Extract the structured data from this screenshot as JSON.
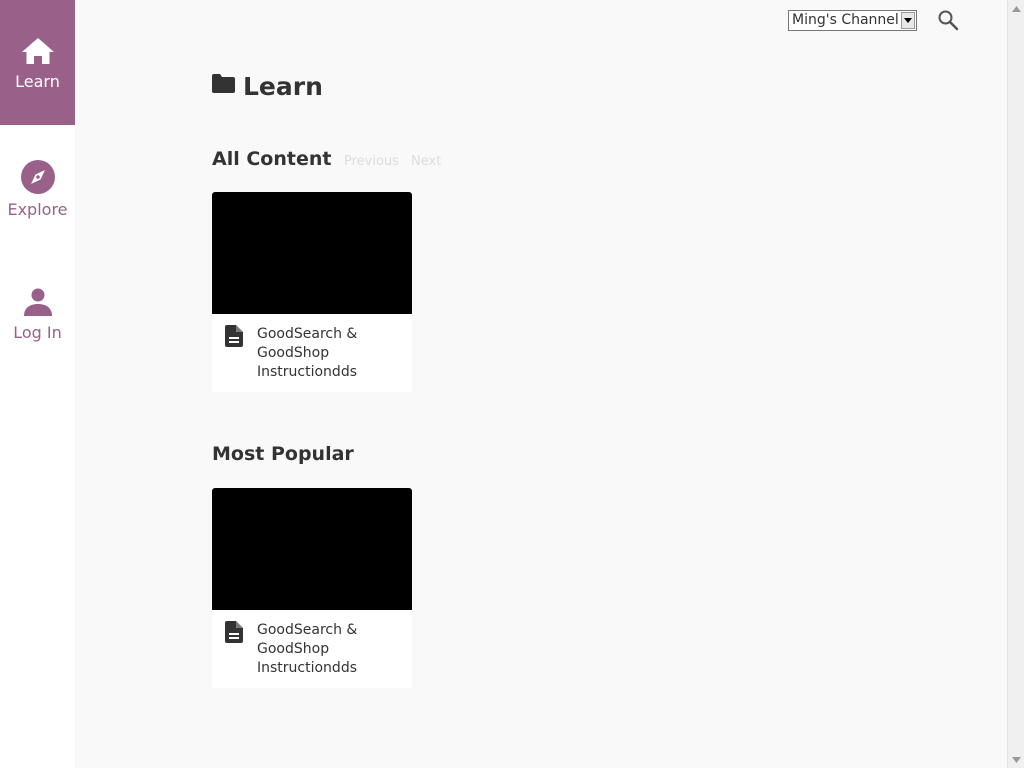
{
  "sidebar": {
    "items": [
      {
        "label": "Learn",
        "icon": "home-icon",
        "active": true
      },
      {
        "label": "Explore",
        "icon": "compass-icon",
        "active": false
      },
      {
        "label": "Log In",
        "icon": "person-icon",
        "active": false
      }
    ]
  },
  "header": {
    "channel_selected": "Ming's Channel",
    "search_icon": "search-icon"
  },
  "main": {
    "title": "Learn",
    "title_icon": "folder-icon",
    "sections": [
      {
        "title": "All Content",
        "pager": {
          "previous": "Previous",
          "next": "Next"
        },
        "cards": [
          {
            "title": "GoodSearch & GoodShop Instructiondds",
            "icon": "document-icon"
          }
        ]
      },
      {
        "title": "Most Popular",
        "cards": [
          {
            "title": "GoodSearch & GoodShop Instructiondds",
            "icon": "document-icon"
          }
        ]
      }
    ]
  },
  "colors": {
    "accent": "#996189",
    "background": "#f9f9f9",
    "thumbnail": "#000000",
    "pager_disabled": "#dcdcdc"
  }
}
